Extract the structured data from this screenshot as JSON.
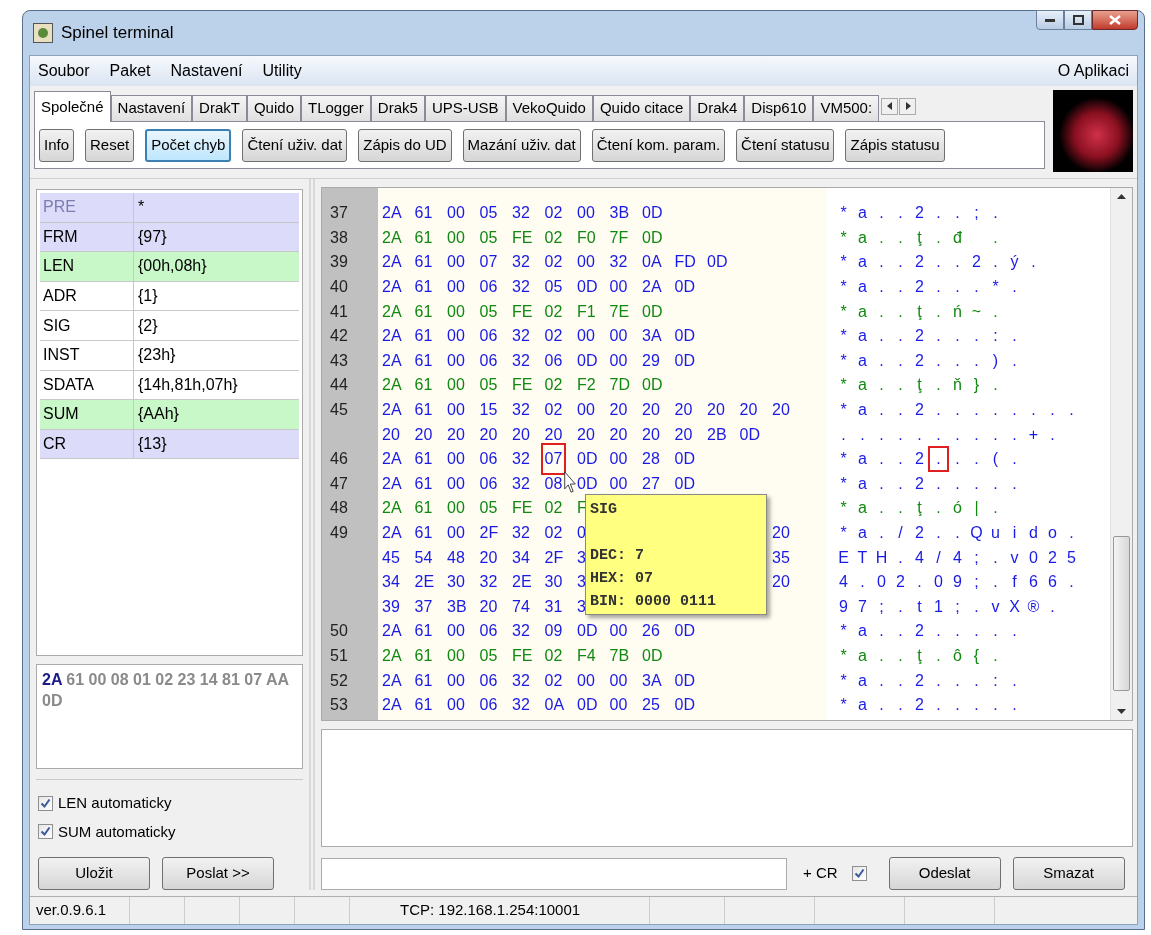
{
  "window": {
    "title": "Spinel terminal"
  },
  "menu": {
    "items": [
      "Soubor",
      "Paket",
      "Nastavení",
      "Utility"
    ],
    "right": "O Aplikaci"
  },
  "tabs": [
    {
      "label": "Společné",
      "selected": true
    },
    {
      "label": "Nastavení",
      "selected": false
    },
    {
      "label": "DrakT",
      "selected": false
    },
    {
      "label": "Quido",
      "selected": false
    },
    {
      "label": "TLogger",
      "selected": false
    },
    {
      "label": "Drak5",
      "selected": false
    },
    {
      "label": "UPS-USB",
      "selected": false
    },
    {
      "label": "VekoQuido",
      "selected": false
    },
    {
      "label": "Quido citace",
      "selected": false
    },
    {
      "label": "Drak4",
      "selected": false
    },
    {
      "label": "Disp610",
      "selected": false
    },
    {
      "label": "VM500:",
      "selected": false
    }
  ],
  "toolbar": [
    {
      "label": "Info",
      "focused": false
    },
    {
      "label": "Reset",
      "focused": false
    },
    {
      "label": "Počet chyb",
      "focused": true
    },
    {
      "label": "Čtení uživ. dat",
      "focused": false
    },
    {
      "label": "Zápis do UD",
      "focused": false
    },
    {
      "label": "Mazání uživ. dat",
      "focused": false
    },
    {
      "label": "Čtení kom. param.",
      "focused": false
    },
    {
      "label": "Čtení statusu",
      "focused": false
    },
    {
      "label": "Zápis statusu",
      "focused": false
    }
  ],
  "packet_fields": [
    {
      "name": "PRE",
      "value": "*",
      "color": "#dcdcfa",
      "disabled": true
    },
    {
      "name": "FRM",
      "value": "{97}",
      "color": "#dcdcfa",
      "disabled": false
    },
    {
      "name": "LEN",
      "value": "{00h,08h}",
      "color": "#c8f8c8",
      "disabled": false
    },
    {
      "name": "ADR",
      "value": "{1}",
      "color": "#ffffff",
      "disabled": false
    },
    {
      "name": "SIG",
      "value": "{2}",
      "color": "#ffffff",
      "disabled": false
    },
    {
      "name": "INST",
      "value": "{23h}",
      "color": "#ffffff",
      "disabled": false
    },
    {
      "name": "SDATA",
      "value": "{14h,81h,07h}",
      "color": "#ffffff",
      "disabled": false
    },
    {
      "name": "SUM",
      "value": "{AAh}",
      "color": "#c8f8c8",
      "disabled": false
    },
    {
      "name": "CR",
      "value": "{13}",
      "color": "#dcdcfa",
      "disabled": false
    }
  ],
  "packet_preview": {
    "lead": "2A",
    "rest": "61 00 08 01 02 23 14 81 07 AA 0D"
  },
  "options": [
    {
      "label": "LEN automaticky",
      "checked": true
    },
    {
      "label": "SUM automaticky",
      "checked": true
    }
  ],
  "left_buttons": [
    "Uložit",
    "Poslat >>"
  ],
  "log_lines": [
    {
      "number": "37",
      "kind": "sent",
      "bytes": [
        "2A",
        "61",
        "00",
        "05",
        "32",
        "02",
        "00",
        "3B",
        "0D"
      ],
      "ascii": [
        "*",
        "a",
        ".",
        ".",
        "2",
        ".",
        ".",
        ";",
        "."
      ]
    },
    {
      "number": "38",
      "kind": "received",
      "bytes": [
        "2A",
        "61",
        "00",
        "05",
        "FE",
        "02",
        "F0",
        "7F",
        "0D"
      ],
      "ascii": [
        "*",
        "a",
        ".",
        ".",
        "ţ",
        ".",
        "đ"
      ],
      "ascii_after": [
        "."
      ]
    },
    {
      "number": "39",
      "kind": "sent",
      "bytes": [
        "2A",
        "61",
        "00",
        "07",
        "32",
        "02",
        "00",
        "32",
        "0A",
        "FD",
        "0D"
      ],
      "ascii": [
        "*",
        "a",
        ".",
        ".",
        "2",
        ".",
        ".",
        "2",
        ".",
        "ý",
        "."
      ]
    },
    {
      "number": "40",
      "kind": "sent",
      "bytes": [
        "2A",
        "61",
        "00",
        "06",
        "32",
        "05",
        "0D",
        "00",
        "2A",
        "0D"
      ],
      "ascii": [
        "*",
        "a",
        ".",
        ".",
        "2",
        ".",
        ".",
        ".",
        "*",
        "."
      ]
    },
    {
      "number": "41",
      "kind": "received",
      "bytes": [
        "2A",
        "61",
        "00",
        "05",
        "FE",
        "02",
        "F1",
        "7E",
        "0D"
      ],
      "ascii": [
        "*",
        "a",
        ".",
        ".",
        "ţ",
        ".",
        "ń",
        "~",
        "."
      ]
    },
    {
      "number": "42",
      "kind": "sent",
      "bytes": [
        "2A",
        "61",
        "00",
        "06",
        "32",
        "02",
        "00",
        "00",
        "3A",
        "0D"
      ],
      "ascii": [
        "*",
        "a",
        ".",
        ".",
        "2",
        ".",
        ".",
        ".",
        ":",
        "."
      ]
    },
    {
      "number": "43",
      "kind": "sent",
      "bytes": [
        "2A",
        "61",
        "00",
        "06",
        "32",
        "06",
        "0D",
        "00",
        "29",
        "0D"
      ],
      "ascii": [
        "*",
        "a",
        ".",
        ".",
        "2",
        ".",
        ".",
        ".",
        ")",
        "."
      ]
    },
    {
      "number": "44",
      "kind": "received",
      "bytes": [
        "2A",
        "61",
        "00",
        "05",
        "FE",
        "02",
        "F2",
        "7D",
        "0D"
      ],
      "ascii": [
        "*",
        "a",
        ".",
        ".",
        "ţ",
        ".",
        "ň",
        "}",
        "."
      ]
    },
    {
      "number": "45",
      "kind": "sent",
      "bytes": [
        "2A",
        "61",
        "00",
        "15",
        "32",
        "02",
        "00",
        "20",
        "20",
        "20",
        "20",
        "20",
        "20"
      ],
      "ascii": [
        "*",
        "a",
        ".",
        ".",
        "2",
        ".",
        ".",
        ".",
        ".",
        ".",
        ".",
        ".",
        "."
      ]
    },
    {
      "kind": "sent",
      "bytes": [
        "20",
        "20",
        "20",
        "20",
        "20",
        "20",
        "20",
        "20",
        "20",
        "20",
        "2B",
        "0D"
      ],
      "ascii": [
        ".",
        ".",
        ".",
        ".",
        ".",
        ".",
        ".",
        ".",
        ".",
        ".",
        "+",
        "."
      ]
    },
    {
      "number": "46",
      "kind": "sent",
      "bytes": [
        "2A",
        "61",
        "00",
        "06",
        "32",
        "07",
        "0D",
        "00",
        "28",
        "0D"
      ],
      "ascii": [
        "*",
        "a",
        ".",
        ".",
        "2",
        ".",
        ".",
        ".",
        "(",
        "."
      ],
      "marked": [
        false,
        false,
        false,
        false,
        false,
        true,
        false,
        false,
        false,
        false
      ]
    },
    {
      "number": "47",
      "kind": "sent",
      "bytes": [
        "2A",
        "61",
        "00",
        "06",
        "32",
        "08",
        "0D",
        "00",
        "27",
        "0D"
      ],
      "ascii": [
        "*",
        "a",
        ".",
        ".",
        "2",
        ".",
        ".",
        ".",
        ".",
        "."
      ]
    },
    {
      "number": "48",
      "kind": "received",
      "bytes": [
        "2A",
        "61",
        "00",
        "05",
        "FE",
        "02",
        "F"
      ],
      "ascii": [
        "*",
        "a",
        ".",
        ".",
        "ţ",
        ".",
        "ó",
        "|",
        "."
      ]
    },
    {
      "number": "49",
      "kind": "sent",
      "bytes": [
        "2A",
        "61",
        "00",
        "2F",
        "32",
        "02",
        "0"
      ],
      "bytes_after": [
        "20"
      ],
      "ascii": [
        "*",
        "a",
        ".",
        "/",
        "2",
        ".",
        ".",
        "Q",
        "u",
        "i",
        "d",
        "o",
        "."
      ]
    },
    {
      "kind": "sent",
      "bytes": [
        "45",
        "54",
        "48",
        "20",
        "34",
        "2F",
        "3"
      ],
      "bytes_after": [
        "35"
      ],
      "ascii": [
        "E",
        "T",
        "H",
        ".",
        "4",
        "/",
        "4",
        ";",
        ".",
        "v",
        "0",
        "2",
        "5"
      ]
    },
    {
      "kind": "sent",
      "bytes": [
        "34",
        "2E",
        "30",
        "32",
        "2E",
        "30",
        "3"
      ],
      "bytes_after": [
        "20"
      ],
      "ascii": [
        "4",
        ".",
        "0",
        "2",
        ".",
        "0",
        "9",
        ";",
        ".",
        "f",
        "6",
        "6",
        "."
      ]
    },
    {
      "kind": "sent",
      "bytes": [
        "39",
        "37",
        "3B",
        "20",
        "74",
        "31",
        "3"
      ],
      "ascii": [
        "9",
        "7",
        ";",
        ".",
        "t",
        "1",
        ";",
        ".",
        "v",
        "X",
        "®",
        "."
      ]
    },
    {
      "number": "50",
      "kind": "sent",
      "bytes": [
        "2A",
        "61",
        "00",
        "06",
        "32",
        "09",
        "0D",
        "00",
        "26",
        "0D"
      ],
      "ascii": [
        "*",
        "a",
        ".",
        ".",
        "2",
        ".",
        ".",
        ".",
        ".",
        "."
      ]
    },
    {
      "number": "51",
      "kind": "received",
      "bytes": [
        "2A",
        "61",
        "00",
        "05",
        "FE",
        "02",
        "F4",
        "7B",
        "0D"
      ],
      "ascii": [
        "*",
        "a",
        ".",
        ".",
        "ţ",
        ".",
        "ô",
        "{",
        "."
      ]
    },
    {
      "number": "52",
      "kind": "sent",
      "bytes": [
        "2A",
        "61",
        "00",
        "06",
        "32",
        "02",
        "00",
        "00",
        "3A",
        "0D"
      ],
      "ascii": [
        "*",
        "a",
        ".",
        ".",
        "2",
        ".",
        ".",
        ".",
        ":",
        "."
      ]
    },
    {
      "number": "53",
      "kind": "sent",
      "bytes": [
        "2A",
        "61",
        "00",
        "06",
        "32",
        "0A",
        "0D",
        "00",
        "25",
        "0D"
      ],
      "ascii": [
        "*",
        "a",
        ".",
        ".",
        "2",
        ".",
        ".",
        ".",
        ".",
        "."
      ]
    }
  ],
  "tooltip": {
    "title": "SIG",
    "lines": [
      "DEC: 7",
      "HEX: 07",
      "BIN: 0000 0111"
    ]
  },
  "send_bar": {
    "cr_label": "+ CR",
    "cr_checked": true,
    "buttons": [
      "Odeslat",
      "Smazat"
    ]
  },
  "status_bar": [
    "ver.0.9.6.1",
    "TCP: 192.168.1.254:10001"
  ]
}
